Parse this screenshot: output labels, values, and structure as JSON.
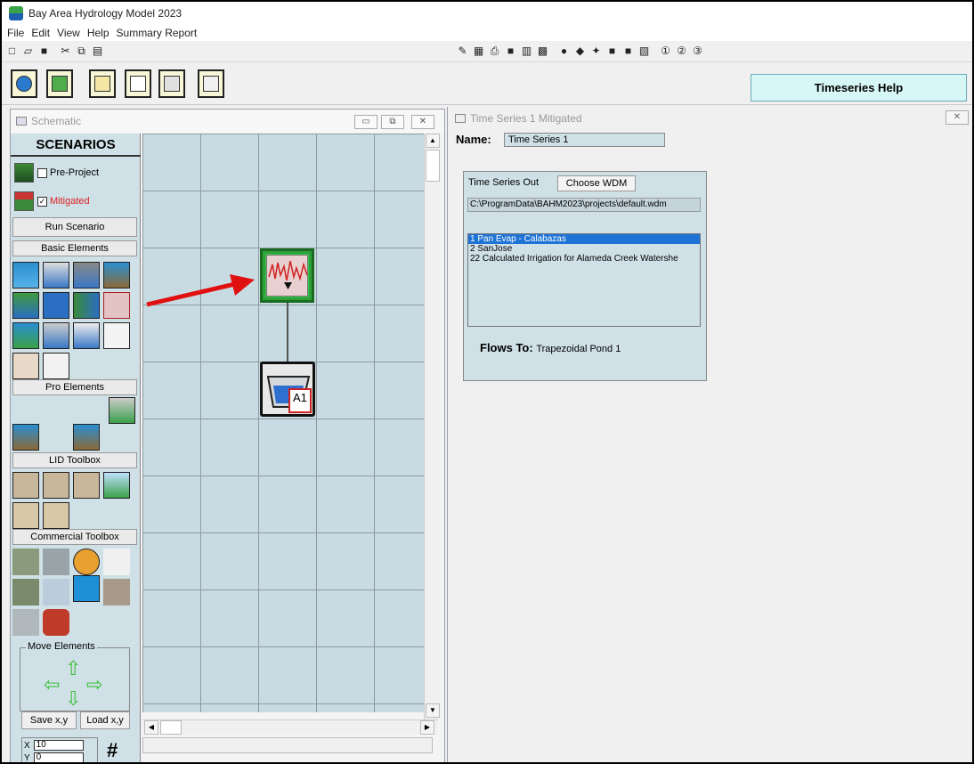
{
  "window": {
    "title": "Bay Area Hydrology Model 2023"
  },
  "menu": [
    "File",
    "Edit",
    "View",
    "Help",
    "Summary Report"
  ],
  "toolbar": {
    "help_button": "Timeseries Help"
  },
  "schematic": {
    "title": "Schematic",
    "scenarios_header": "SCENARIOS",
    "pre_project_label": "Pre-Project",
    "mitigated_label": "Mitigated",
    "mitigated_checked": true,
    "run_scenario": "Run Scenario",
    "basic_elements": "Basic Elements",
    "pro_elements": "Pro Elements",
    "lid_toolbox": "LID Toolbox",
    "commercial_toolbox": "Commercial Toolbox",
    "move_elements": "Move Elements",
    "save_xy": "Save x,y",
    "load_xy": "Load x,y",
    "x_label": "X",
    "x_value": "10",
    "y_label": "Y",
    "y_value": "0",
    "pond_tag": "A1"
  },
  "timeseries": {
    "window_title": "Time Series 1 Mitigated",
    "name_label": "Name:",
    "name_value": "Time Series 1",
    "out_label": "Time Series Out",
    "choose_wdm": "Choose WDM",
    "path": "C:\\ProgramData\\BAHM2023\\projects\\default.wdm",
    "list": [
      "1  Pan Evap - Calabazas",
      "2  SanJose",
      "22  Calculated Irrigation for Alameda Creek Watershe"
    ],
    "selected_index": 0,
    "flows_to_label": "Flows To:",
    "flows_to_value": "Trapezoidal Pond 1"
  },
  "colors": {
    "annotation_arrow": "#e01010",
    "selection": "#1e73d6",
    "panel": "#cfe0e6",
    "help_button": "#d7f6f6"
  }
}
